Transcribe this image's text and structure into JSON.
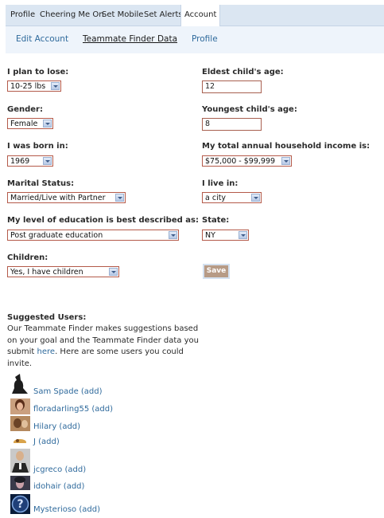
{
  "topnav": {
    "tabs": [
      "Profile",
      "Cheering Me On",
      "Set Mobile",
      "Set Alerts",
      "Account"
    ],
    "active": "Account"
  },
  "subnav": {
    "items": [
      "Edit Account",
      "Teammate Finder Data",
      "Profile"
    ],
    "active": "Teammate Finder Data"
  },
  "form": {
    "lose": {
      "label": "I plan to lose:",
      "value": "10-25 lbs"
    },
    "gender": {
      "label": "Gender:",
      "value": "Female"
    },
    "born": {
      "label": "I was born in:",
      "value": "1969"
    },
    "marital": {
      "label": "Marital Status:",
      "value": "Married/Live with Partner"
    },
    "education": {
      "label": "My level of education is best described as:",
      "value": "Post graduate education"
    },
    "children": {
      "label": "Children:",
      "value": "Yes, I have children"
    },
    "eldest": {
      "label": "Eldest child's age:",
      "value": "12"
    },
    "youngest": {
      "label": "Youngest child's age:",
      "value": "8"
    },
    "income": {
      "label": "My total annual household income is:",
      "value": "$75,000 - $99,999"
    },
    "live": {
      "label": "I live in:",
      "value": "a city"
    },
    "state": {
      "label": "State:",
      "value": "NY"
    },
    "save_label": "Save"
  },
  "suggested": {
    "title": "Suggested Users:",
    "text_before": "Our Teammate Finder makes suggestions based on your goal and the Teammate Finder data you submit ",
    "link": "here",
    "text_after": ". Here are some users you could invite.",
    "add_label": "(add)",
    "users": [
      "Sam Spade",
      "floradarling55",
      "Hilary",
      "J",
      "jcgreco",
      "idohair",
      "Mysterioso"
    ]
  }
}
